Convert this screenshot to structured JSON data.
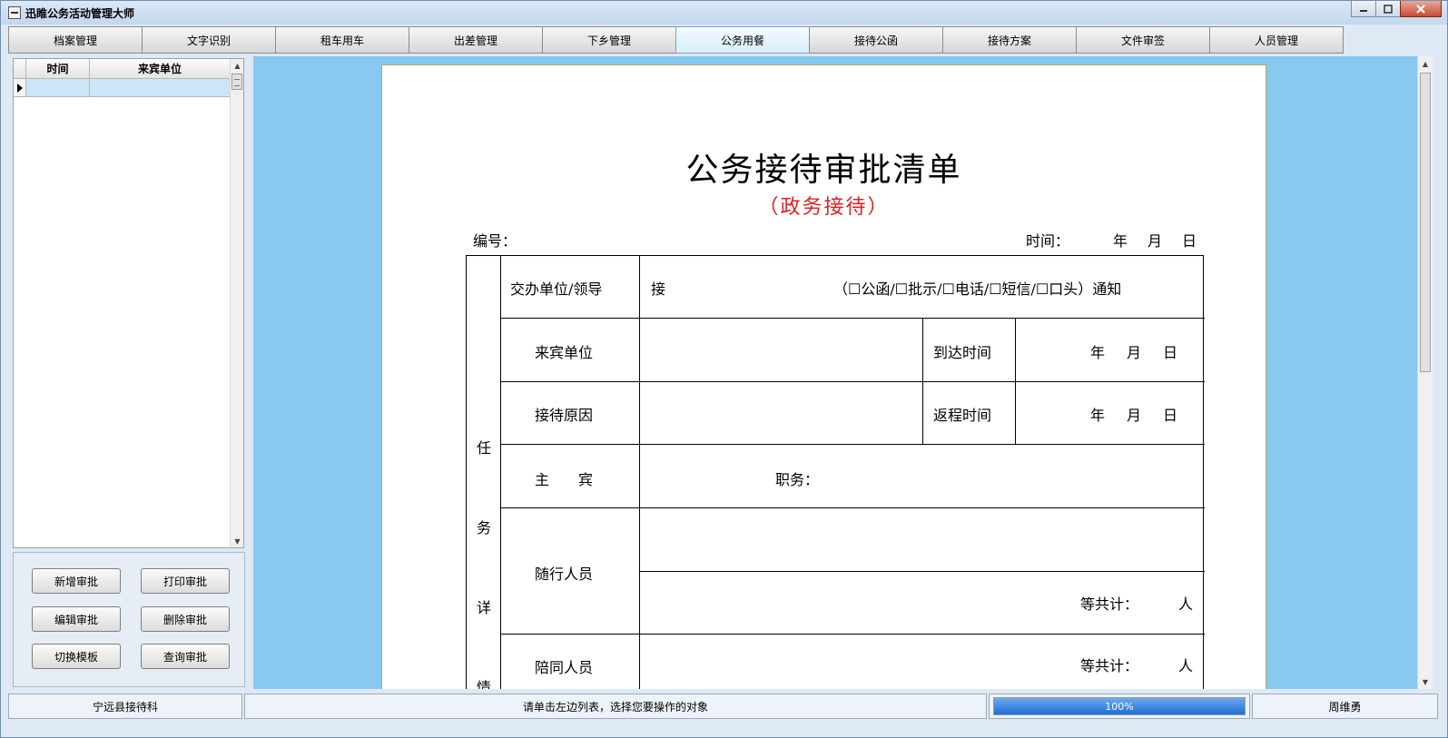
{
  "window": {
    "title": "迅睢公务活动管理大师"
  },
  "tabs": [
    "档案管理",
    "文字识别",
    "租车用车",
    "出差管理",
    "下乡管理",
    "公务用餐",
    "接待公函",
    "接待方案",
    "文件审签",
    "人员管理"
  ],
  "active_tab": "公务用餐",
  "grid": {
    "col_time": "时间",
    "col_unit": "来宾单位"
  },
  "buttons": {
    "add": "新增审批",
    "print": "打印审批",
    "edit": "编辑审批",
    "delete": "删除审批",
    "switch": "切换模板",
    "query": "查询审批"
  },
  "document": {
    "title": "公务接待审批清单",
    "subtitle": "（政务接待）",
    "no_label": "编号：",
    "time_label": "时间：",
    "year": "年",
    "month": "月",
    "day": "日",
    "side_label": [
      "任",
      "务",
      "详",
      "情"
    ],
    "row1_label": "交办单位/领导",
    "row1_prefix": "接",
    "row1_options": "（☐公函/☐批示/☐电话/☐短信/☐口头）通知",
    "row2_label": "来宾单位",
    "row2_right_label": "到达时间",
    "row3_label": "接待原因",
    "row3_right_label": "返程时间",
    "row4_label": "主　　宾",
    "row4_duty": "职务：",
    "row5_label": "随行人员",
    "total_label": "等共计：",
    "person_unit": "人",
    "row6_label": "陪同人员"
  },
  "status": {
    "dept": "宁远县接待科",
    "hint": "请单击左边列表，选择您要操作的对象",
    "progress_text": "100%",
    "progress_value": 1.0,
    "user": "周维勇"
  },
  "colors": {
    "doc_bg": "#87c9ef",
    "subtitle": "#e02020",
    "progress": "#1f6fd6"
  }
}
